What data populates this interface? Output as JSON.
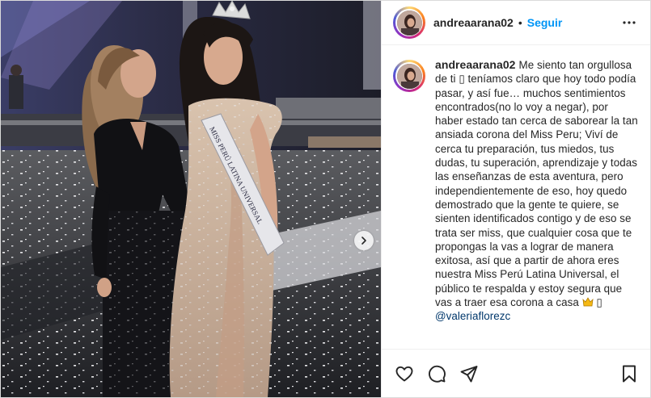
{
  "post": {
    "username": "andreaarana02",
    "separator": "•",
    "follow_label": "Seguir",
    "caption_parts": {
      "text": "Me siento tan orgullosa de ti ▯ teníamos claro que hoy todo podía pasar, y así fue… muchos sentimientos encontrados(no lo voy a negar), por haber estado tan cerca de saborear la tan ansiada corona del Miss Peru; Viví de cerca tu preparación, tus miedos, tus dudas, tu superación, aprendizaje y todas las enseñanzas de esta aventura, pero independientemente de eso, hoy quedo demostrado que la gente te quiere, se sienten identificados contigo y de eso se trata ser miss, que cualquier cosa que te propongas la vas a lograr de manera exitosa, así que a partir de ahora eres nuestra Miss Perú Latina Universal, el público te respalda y estoy segura que vas a traer esa corona a casa",
      "after_crown": " ▯ ",
      "mention": "@valeriaflorezc"
    },
    "sash_text": "MISS PERÚ LATINA UNIVERSAL"
  },
  "icons": {
    "more": "more-horizontal-icon",
    "like": "heart-icon",
    "comment": "comment-icon",
    "share": "paper-plane-icon",
    "save": "bookmark-icon",
    "next": "chevron-right-icon",
    "crown": "crown-emoji-icon"
  },
  "colors": {
    "follow": "#0095f6",
    "text": "#262626",
    "mention": "#00376b"
  }
}
